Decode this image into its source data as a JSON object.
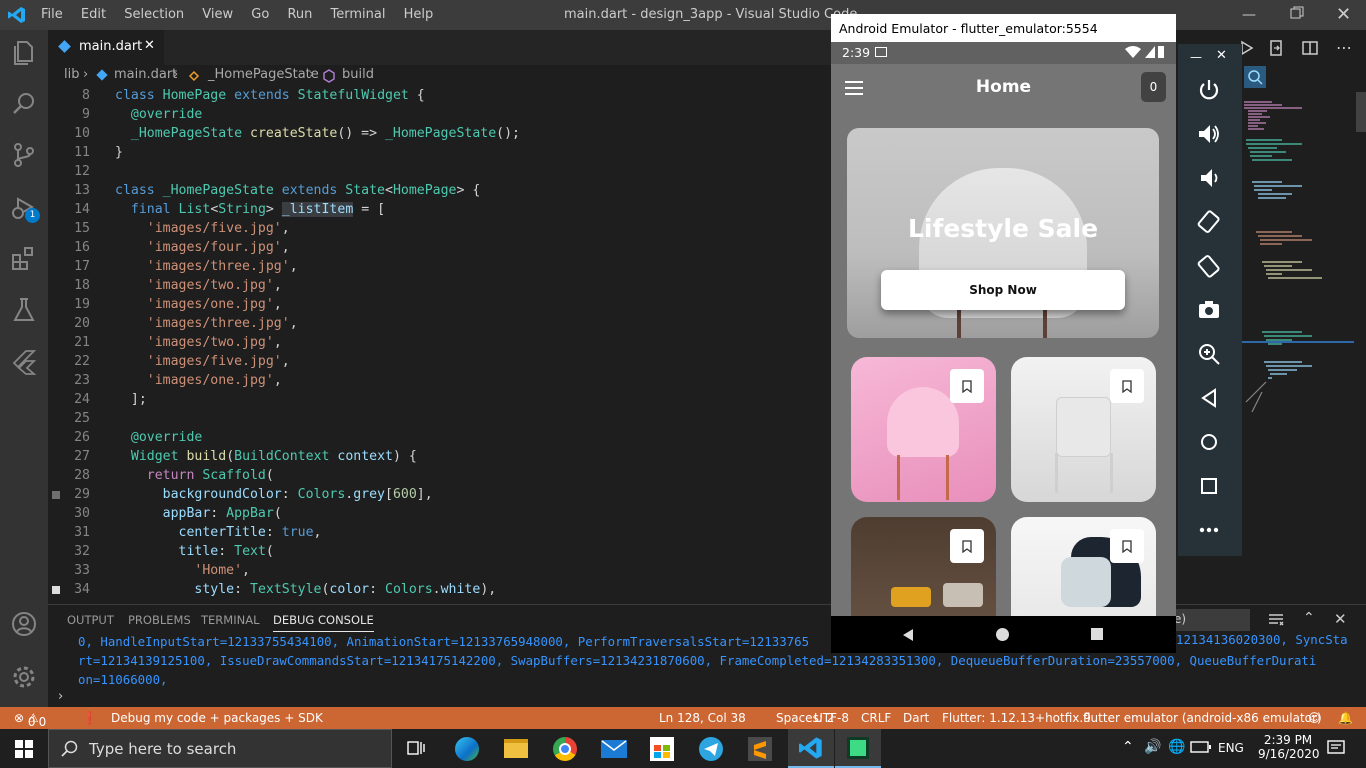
{
  "titlebar": {
    "menu": [
      "File",
      "Edit",
      "Selection",
      "View",
      "Go",
      "Run",
      "Terminal",
      "Help"
    ],
    "title": "main.dart - design_3app - Visual Studio Code"
  },
  "activity": {
    "debug_badge": "1"
  },
  "tabs": {
    "active": "main.dart"
  },
  "breadcrumb": {
    "items": [
      "lib",
      "main.dart",
      "_HomePageState",
      "build"
    ]
  },
  "editor": {
    "line_numbers": [
      "8",
      "9",
      "10",
      "11",
      "12",
      "13",
      "14",
      "15",
      "16",
      "17",
      "18",
      "19",
      "20",
      "21",
      "22",
      "23",
      "24",
      "25",
      "26",
      "27",
      "28",
      "29",
      "30",
      "31",
      "32",
      "33",
      "34"
    ]
  },
  "panel": {
    "tabs": [
      "OUTPUT",
      "PROBLEMS",
      "TERMINAL",
      "DEBUG CONSOLE"
    ],
    "active_tab": "DEBUG CONSOLE",
    "filter_partial": "e)",
    "console_lines": [
      "0, HandleInputStart=12133755434100, AnimationStart=12133765948000, PerformTraversalsStart=12133765",
      "rt=12134139125100, IssueDrawCommandsStart=12134175142200, SwapBuffers=12134231870600, FrameCompleted=12134283351300, DequeueBufferDuration=23557000, QueueBufferDurati",
      "on=11066000,"
    ],
    "console_right_frag": "12134136020300, SyncSta"
  },
  "statusbar": {
    "problems": "0",
    "warnings": "0",
    "debug_config": "Debug my code + packages + SDK",
    "position": "Ln 128, Col 38",
    "spaces": "Spaces: 2",
    "encoding": "UTF-8",
    "eol": "CRLF",
    "language": "Dart",
    "flutter": "Flutter: 1.12.13+hotfix.9",
    "device": "flutter emulator (android-x86 emulator)"
  },
  "taskbar": {
    "search_placeholder": "Type here to search",
    "lang": "ENG",
    "time": "2:39 PM",
    "date": "9/16/2020"
  },
  "emulator": {
    "window_title": "Android Emulator - flutter_emulator:5554",
    "status_time": "2:39",
    "app_title": "Home",
    "cart_count": "0",
    "hero_title": "Lifestyle Sale",
    "hero_button": "Shop Now"
  },
  "colors": {
    "accent_vscode": "#007acc",
    "statusbar": "#cc6633",
    "app_background": "#757575"
  }
}
